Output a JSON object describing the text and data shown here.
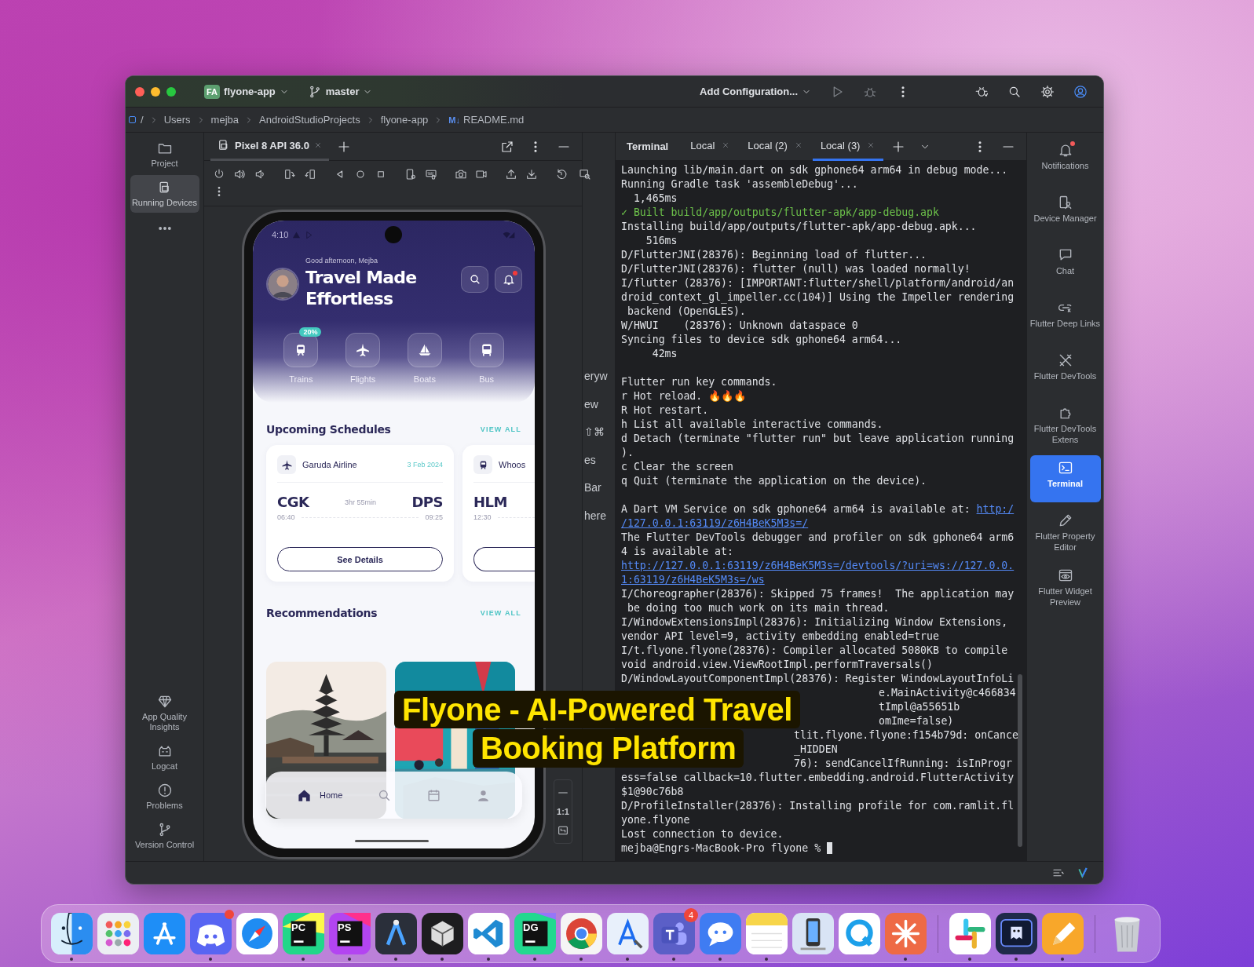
{
  "window": {
    "project": {
      "badge": "FA",
      "name": "flyone-app"
    },
    "branch": "master",
    "run_config": "Add Configuration...",
    "breadcrumbs": [
      "/",
      "Users",
      "mejba",
      "AndroidStudioProjects",
      "flyone-app"
    ],
    "file": {
      "badge": "M↓",
      "name": "README.md"
    },
    "left_tools": [
      {
        "label": "Project",
        "selected": false
      },
      {
        "label": "Running Devices",
        "selected": true
      }
    ],
    "left_tools_bottom": [
      "App Quality Insights",
      "Logcat",
      "Problems",
      "Version Control"
    ],
    "right_tools": [
      {
        "label": "Notifications",
        "selected": false,
        "alert": true
      },
      {
        "label": "Device Manager",
        "selected": false,
        "alert": false
      },
      {
        "label": "Chat",
        "selected": false,
        "alert": false
      },
      {
        "label": "Flutter Deep Links",
        "selected": false,
        "alert": false
      },
      {
        "label": "Flutter DevTools",
        "selected": false,
        "alert": false
      },
      {
        "label": "Flutter DevTools Extens",
        "selected": false,
        "alert": false
      },
      {
        "label": "Terminal",
        "selected": true,
        "alert": false
      },
      {
        "label": "Flutter Property Editor",
        "selected": false,
        "alert": false
      },
      {
        "label": "Flutter Widget Preview",
        "selected": false,
        "alert": false
      }
    ]
  },
  "running_devices": {
    "tabs": [
      {
        "label": "Pixel 8 API 36.0",
        "selected": true
      }
    ],
    "zoom_label": "1:1"
  },
  "background_panel": [
    "eryw",
    "ew",
    "⇧⌘",
    "es",
    "Bar",
    "here"
  ],
  "phone": {
    "status_time": "4:10",
    "greeting": "Good afternoon, Mejba",
    "headline": "Travel Made Effortless",
    "categories": [
      {
        "label": "Trains",
        "badge": "20%"
      },
      {
        "label": "Flights"
      },
      {
        "label": "Boats"
      },
      {
        "label": "Bus"
      }
    ],
    "schedules": {
      "title": "Upcoming Schedules",
      "action": "VIEW ALL",
      "cards": [
        {
          "kind": "flight",
          "carrier": "Garuda Airline",
          "date": "3 Feb 2024",
          "from": "CGK",
          "duration": "3hr 55min",
          "to": "DPS",
          "depart": "06:40",
          "arrive": "09:25",
          "button": "See Details"
        },
        {
          "kind": "train",
          "carrier": "Whoos",
          "from": "HLM",
          "depart": "12:30"
        }
      ]
    },
    "recommendations": {
      "title": "Recommendations",
      "action": "VIEW ALL"
    },
    "nav": [
      {
        "label": "Home",
        "selected": true
      },
      {
        "selected": false
      },
      {
        "selected": false
      },
      {
        "selected": false
      }
    ]
  },
  "terminal": {
    "title": "Terminal",
    "tabs": [
      {
        "label": "Local",
        "selected": false
      },
      {
        "label": "Local (2)",
        "selected": false
      },
      {
        "label": "Local (3)",
        "selected": true
      }
    ],
    "lines": [
      {
        "kind": "plain",
        "text": "Launching lib/main.dart on sdk gphone64 arm64 in debug mode..."
      },
      {
        "kind": "plain",
        "text": "Running Gradle task 'assembleDebug'..."
      },
      {
        "kind": "plain",
        "text": "  1,465ms"
      },
      {
        "kind": "success",
        "text": "✓ Built build/app/outputs/flutter-apk/app-debug.apk"
      },
      {
        "kind": "plain",
        "text": "Installing build/app/outputs/flutter-apk/app-debug.apk..."
      },
      {
        "kind": "plain",
        "text": "    516ms"
      },
      {
        "kind": "plain",
        "text": "D/FlutterJNI(28376): Beginning load of flutter..."
      },
      {
        "kind": "plain",
        "text": "D/FlutterJNI(28376): flutter (null) was loaded normally!"
      },
      {
        "kind": "plain",
        "text": "I/flutter (28376): [IMPORTANT:flutter/shell/platform/android/an"
      },
      {
        "kind": "plain",
        "text": "droid_context_gl_impeller.cc(104)] Using the Impeller rendering"
      },
      {
        "kind": "plain",
        "text": " backend (OpenGLES)."
      },
      {
        "kind": "plain",
        "text": "W/HWUI    (28376): Unknown dataspace 0"
      },
      {
        "kind": "plain",
        "text": "Syncing files to device sdk gphone64 arm64..."
      },
      {
        "kind": "plain",
        "text": "     42ms"
      },
      {
        "kind": "blank"
      },
      {
        "kind": "plain",
        "text": "Flutter run key commands."
      },
      {
        "kind": "plain",
        "text": "r Hot reload. 🔥🔥🔥"
      },
      {
        "kind": "plain",
        "text": "R Hot restart."
      },
      {
        "kind": "plain",
        "text": "h List all available interactive commands."
      },
      {
        "kind": "plain",
        "text": "d Detach (terminate \"flutter run\" but leave application running"
      },
      {
        "kind": "plain",
        "text": ")."
      },
      {
        "kind": "plain",
        "text": "c Clear the screen"
      },
      {
        "kind": "plain",
        "text": "q Quit (terminate the application on the device)."
      },
      {
        "kind": "blank"
      },
      {
        "kind": "plain",
        "text": "A Dart VM Service on sdk gphone64 arm64 is available at: ",
        "link": "http:/"
      },
      {
        "kind": "link",
        "link": "/127.0.0.1:63119/z6H4BeK5M3s=/"
      },
      {
        "kind": "plain",
        "text": "The Flutter DevTools debugger and profiler on sdk gphone64 arm6"
      },
      {
        "kind": "plain",
        "text": "4 is available at:"
      },
      {
        "kind": "link",
        "link": "http://127.0.0.1:63119/z6H4BeK5M3s=/devtools/?uri=ws://127.0.0."
      },
      {
        "kind": "link",
        "link": "1:63119/z6H4BeK5M3s=/ws"
      },
      {
        "kind": "plain",
        "text": "I/Choreographer(28376): Skipped 75 frames!  The application may"
      },
      {
        "kind": "plain",
        "text": " be doing too much work on its main thread."
      },
      {
        "kind": "plain",
        "text": "I/WindowExtensionsImpl(28376): Initializing Window Extensions,"
      },
      {
        "kind": "plain",
        "text": "vendor API level=9, activity embedding enabled=true"
      },
      {
        "kind": "plain",
        "text": "I/t.flyone.flyone(28376): Compiler allocated 5080KB to compile"
      },
      {
        "kind": "plain",
        "text": "void android.view.ViewRootImpl.performTraversals()"
      },
      {
        "kind": "plain",
        "text": "D/WindowLayoutComponentImpl(28376): Register WindowLayoutInfoLi"
      },
      {
        "kind": "covered",
        "text": "e.MainActivity@c466834"
      },
      {
        "kind": "covered",
        "text": "tImpl@a55651b"
      },
      {
        "kind": "covered",
        "text": "omIme=false)"
      },
      {
        "kind": "half-covered",
        "text": "tlit.flyone.flyone:f154b79d: onCance"
      },
      {
        "kind": "half-covered",
        "text": "_HIDDEN"
      },
      {
        "kind": "half-covered",
        "text": "76): sendCancelIfRunning: isInProgr"
      },
      {
        "kind": "plain",
        "text": "ess=false callback=10.flutter.embedding.android.FlutterActivity"
      },
      {
        "kind": "plain",
        "text": "$1@90c76b8"
      },
      {
        "kind": "plain",
        "text": "D/ProfileInstaller(28376): Installing profile for com.ramlit.fl"
      },
      {
        "kind": "plain",
        "text": "yone.flyone"
      },
      {
        "kind": "plain",
        "text": "Lost connection to device."
      },
      {
        "kind": "prompt",
        "text": "mejba@Engrs-MacBook-Pro flyone % "
      }
    ]
  },
  "caption": [
    "Flyone - AI-Powered Travel",
    "Booking Platform"
  ],
  "dock": [
    [
      {
        "kind": "finder",
        "running": true
      },
      {
        "kind": "launchpad",
        "running": false
      },
      {
        "kind": "appstore",
        "running": false
      },
      {
        "kind": "discord",
        "running": true,
        "notification": true
      },
      {
        "kind": "safari",
        "running": false
      },
      {
        "kind": "pycharm",
        "label": "PC",
        "running": true
      },
      {
        "kind": "phpstorm",
        "label": "PS",
        "running": true
      },
      {
        "kind": "android",
        "running": true
      },
      {
        "kind": "cube",
        "running": true
      },
      {
        "kind": "vscode",
        "running": true
      },
      {
        "kind": "datagrip",
        "label": "DG",
        "running": true
      },
      {
        "kind": "chrome",
        "running": true
      },
      {
        "kind": "xcode",
        "running": true
      },
      {
        "kind": "teams",
        "running": true,
        "badge": "4"
      },
      {
        "kind": "bubble",
        "running": true
      },
      {
        "kind": "notes",
        "running": true
      },
      {
        "kind": "simulator",
        "running": false
      },
      {
        "kind": "qapp",
        "running": false
      },
      {
        "kind": "asterisk",
        "running": true
      }
    ],
    [
      {
        "kind": "slack",
        "running": true
      },
      {
        "kind": "terminal",
        "running": true
      },
      {
        "kind": "pages",
        "running": true
      }
    ],
    [
      {
        "kind": "trash",
        "running": false
      }
    ]
  ]
}
